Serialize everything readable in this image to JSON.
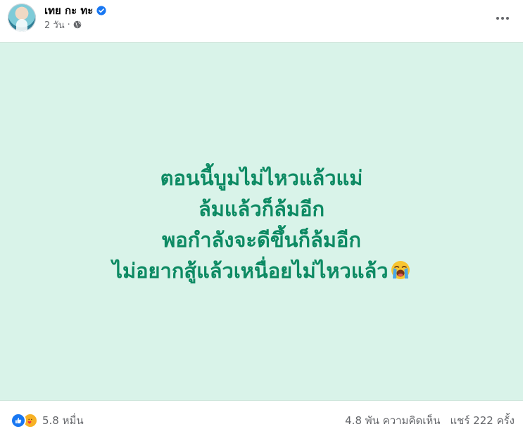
{
  "post": {
    "author": "เทย กะ ทะ",
    "time": "2 วัน",
    "separator": "·",
    "lines": [
      "ตอนนี้บูมไม่ไหวแล้วแม่",
      "ล้มแล้วก็ล้มอีก",
      "พอกำลังจะดีขึ้นก็ล้มอีก",
      "ไม่อยากสู้แล้วเหนื่อยไม่ไหวแล้ว"
    ],
    "emoji": "loudly-crying-face",
    "background_color": "#d9f3e9",
    "text_color": "#0d8a63"
  },
  "stats": {
    "reactions": "5.8 หมื่น",
    "comments": "4.8 พัน ความคิดเห็น",
    "shares": "แชร์ 222 ครั้ง"
  },
  "icons": {
    "verified": "verified-badge-icon",
    "audience": "globe-icon",
    "more": "more-options-icon",
    "reactions": [
      "like-icon",
      "care-icon"
    ]
  }
}
